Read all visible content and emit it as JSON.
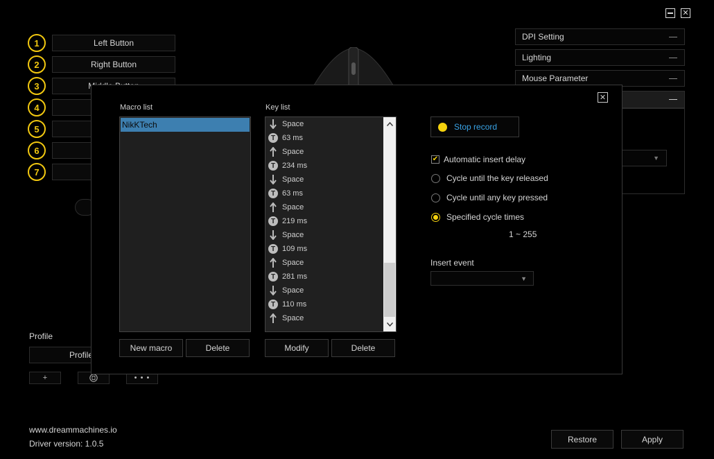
{
  "window": {
    "minimize_icon": "minimize-icon",
    "close_icon": "close-icon"
  },
  "buttons": [
    {
      "num": "1",
      "label": "Left Button"
    },
    {
      "num": "2",
      "label": "Right Button"
    },
    {
      "num": "3",
      "label": "Middle Button"
    },
    {
      "num": "4",
      "label": ""
    },
    {
      "num": "5",
      "label": ""
    },
    {
      "num": "6",
      "label": ""
    },
    {
      "num": "7",
      "label": ""
    }
  ],
  "side_panels": [
    {
      "label": "DPI Setting"
    },
    {
      "label": "Lighting"
    },
    {
      "label": "Mouse Parameter"
    },
    {
      "label": ""
    }
  ],
  "profile": {
    "label": "Profile",
    "current": "Profile 1",
    "add": "+",
    "more": "• • •"
  },
  "footer": {
    "website": "www.dreammachines.io",
    "driver_version": "Driver version: 1.0.5",
    "restore": "Restore",
    "apply": "Apply"
  },
  "macro_dialog": {
    "macro_list_label": "Macro list",
    "key_list_label": "Key list",
    "macros": [
      {
        "name": "NikKTech",
        "selected": true
      }
    ],
    "keys": [
      {
        "type": "down",
        "text": "Space"
      },
      {
        "type": "delay",
        "text": "63 ms"
      },
      {
        "type": "up",
        "text": "Space"
      },
      {
        "type": "delay",
        "text": "234 ms"
      },
      {
        "type": "down",
        "text": "Space"
      },
      {
        "type": "delay",
        "text": "63 ms"
      },
      {
        "type": "up",
        "text": "Space"
      },
      {
        "type": "delay",
        "text": "219 ms"
      },
      {
        "type": "down",
        "text": "Space"
      },
      {
        "type": "delay",
        "text": "109 ms"
      },
      {
        "type": "up",
        "text": "Space"
      },
      {
        "type": "delay",
        "text": "281 ms"
      },
      {
        "type": "down",
        "text": "Space"
      },
      {
        "type": "delay",
        "text": "110 ms"
      },
      {
        "type": "up",
        "text": "Space"
      }
    ],
    "new_macro": "New macro",
    "delete_macro": "Delete",
    "modify": "Modify",
    "delete_key": "Delete",
    "stop_record": "Stop record",
    "options": {
      "auto_delay": "Automatic insert delay",
      "auto_delay_checked": true,
      "cycle_release": "Cycle until the key released",
      "cycle_any": "Cycle until any key pressed",
      "cycle_times": "Specified cycle times",
      "selected": "cycle_times"
    },
    "range": "1 ~ 255",
    "insert_event_label": "Insert event",
    "insert_event_value": "",
    "timer_glyph": "T"
  },
  "colors": {
    "accent": "#f5d20e",
    "link": "#39a3e6",
    "selection": "#3d7fb0"
  }
}
